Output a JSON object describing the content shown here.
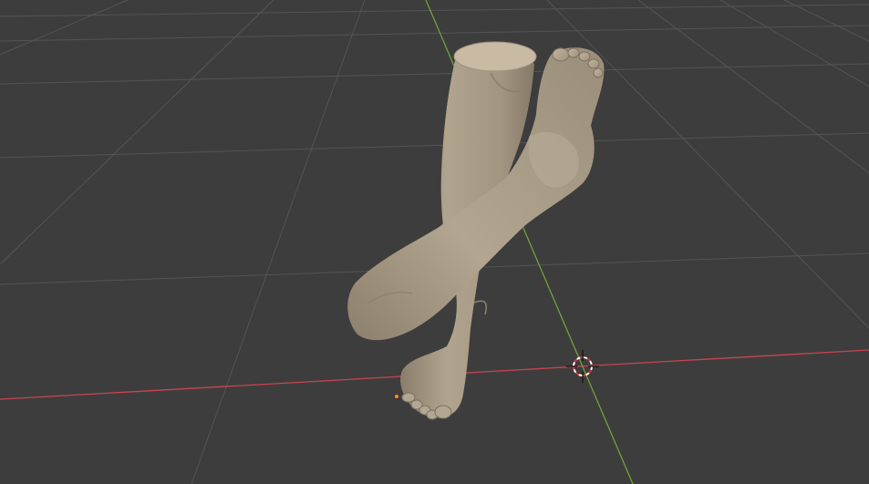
{
  "viewport": {
    "mode": "3D Viewport",
    "background_color": "#3d3d3d",
    "grid_color": "#545454",
    "x_axis_color": "#c9444f",
    "y_axis_color": "#71a13c",
    "mesh_color": "#a89b86",
    "origin_color": "#ff8c1a",
    "cursor_color_primary": "#ffffff",
    "cursor_color_secondary": "#d9373b"
  },
  "scene": {
    "objects": [
      {
        "name": "vertical-leg-with-foot",
        "type": "mesh",
        "selected": true
      },
      {
        "name": "bent-leg-with-foot",
        "type": "mesh",
        "selected": true
      }
    ],
    "widgets": [
      {
        "name": "3d-cursor"
      },
      {
        "name": "object-origin"
      }
    ]
  }
}
